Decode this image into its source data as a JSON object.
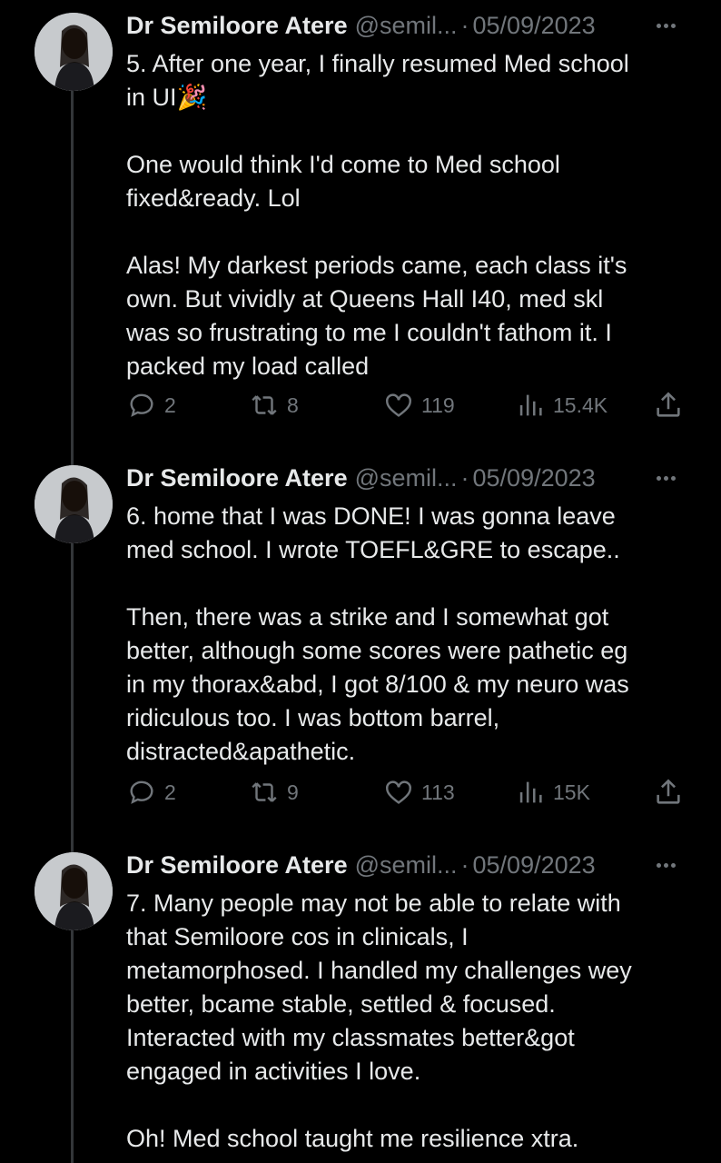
{
  "tweets": [
    {
      "author_name": "Dr Semiloore Atere",
      "handle": "@semil...",
      "separator": "·",
      "date": "05/09/2023",
      "text": "5. After one year, I finally resumed Med school\nin UI🎉\n\nOne would think I'd come to Med school\nfixed&ready. Lol\n\nAlas! My darkest periods came, each class it's\nown. But vividly at Queens Hall I40, med skl\nwas so frustrating to me I couldn't fathom it. I\npacked my load called",
      "replies": "2",
      "retweets": "8",
      "likes": "119",
      "views": "15.4K"
    },
    {
      "author_name": "Dr Semiloore Atere",
      "handle": "@semil...",
      "separator": "·",
      "date": "05/09/2023",
      "text": "6. home that I was DONE! I was gonna leave\nmed school. I wrote TOEFL&GRE to escape..\n\nThen, there was a strike and I somewhat got\nbetter, although some scores were pathetic eg\nin my thorax&abd, I got 8/100 & my neuro was\nridiculous too. I was bottom barrel,\ndistracted&apathetic.",
      "replies": "2",
      "retweets": "9",
      "likes": "113",
      "views": "15K"
    },
    {
      "author_name": "Dr Semiloore Atere",
      "handle": "@semil...",
      "separator": "·",
      "date": "05/09/2023",
      "text": "7. Many people may not be able to relate with\nthat Semiloore cos in clinicals, I\nmetamorphosed. I handled my challenges wey\nbetter, bcame stable, settled & focused.\nInteracted with my classmates better&got\nengaged in activities I love.\n\nOh! Med school taught me resilience xtra."
    }
  ],
  "colors": {
    "background": "#000000",
    "text": "#e7e9ea",
    "muted": "#71767b",
    "thread_line": "#333639"
  },
  "icons": [
    "reply-icon",
    "retweet-icon",
    "like-icon",
    "views-icon",
    "share-icon",
    "more-icon"
  ]
}
